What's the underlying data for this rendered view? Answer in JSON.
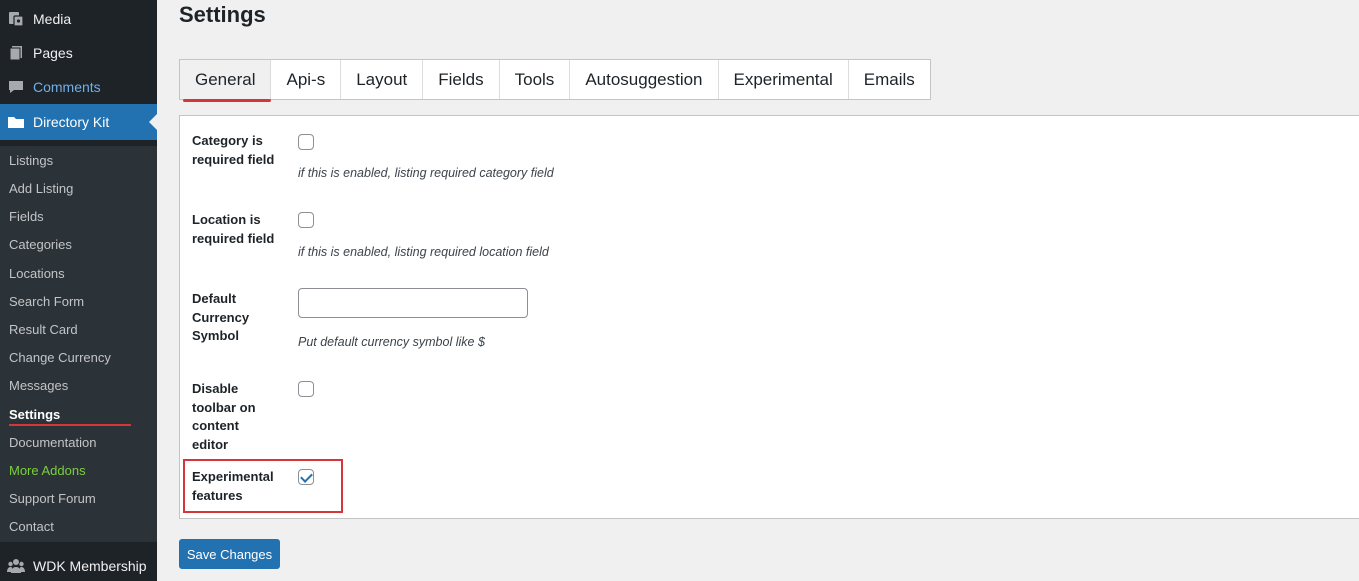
{
  "sidebar": {
    "top_items": [
      {
        "label": "Media",
        "icon": "media-icon"
      },
      {
        "label": "Pages",
        "icon": "pages-icon"
      },
      {
        "label": "Comments",
        "icon": "comments-icon"
      },
      {
        "label": "Directory Kit",
        "icon": "folder-icon"
      }
    ],
    "submenu": [
      "Listings",
      "Add Listing",
      "Fields",
      "Categories",
      "Locations",
      "Search Form",
      "Result Card",
      "Change Currency",
      "Messages",
      "Settings",
      "Documentation",
      "More Addons",
      "Support Forum",
      "Contact"
    ],
    "bottom_item": {
      "label": "WDK Membership",
      "icon": "membership-icon"
    },
    "current": "Settings",
    "colors": {
      "bg": "#1d2327",
      "active": "#2271b1",
      "addon": "#7ad03a",
      "highlight": "#d63638"
    }
  },
  "page": {
    "title": "Settings"
  },
  "tabs": [
    "General",
    "Api-s",
    "Layout",
    "Fields",
    "Tools",
    "Autosuggestion",
    "Experimental",
    "Emails"
  ],
  "active_tab": "General",
  "fields": {
    "category": {
      "label": "Category is required field",
      "desc": "if this is enabled, listing required category field",
      "checked": false
    },
    "location": {
      "label": "Location is required field",
      "desc": "if this is enabled, listing required location field",
      "checked": false
    },
    "currency": {
      "label": "Default Currency Symbol",
      "value": "",
      "desc": "Put default currency symbol like $"
    },
    "toolbar": {
      "label": "Disable toolbar on content editor",
      "checked": false
    },
    "experimental": {
      "label": "Experimental features",
      "checked": true
    }
  },
  "save_button": "Save Changes"
}
